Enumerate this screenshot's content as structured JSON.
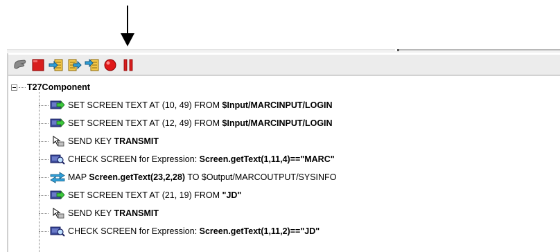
{
  "toolbar": {
    "buttons": [
      {
        "name": "pointer-icon",
        "label": ""
      },
      {
        "name": "stop-icon",
        "label": ""
      },
      {
        "name": "step-into-icon",
        "label": ""
      },
      {
        "name": "step-over-icon",
        "label": ""
      },
      {
        "name": "step-out-icon",
        "label": ""
      },
      {
        "name": "record-icon",
        "label": ""
      },
      {
        "name": "pause-icon",
        "label": ""
      }
    ]
  },
  "tree": {
    "root_label": "T27Component",
    "rows": [
      {
        "icon": "set-screen-icon",
        "prefix": "SET SCREEN TEXT AT (10, 49) FROM ",
        "bold": "$Input/MARCINPUT/LOGIN",
        "suffix": ""
      },
      {
        "icon": "set-screen-icon",
        "prefix": "SET SCREEN TEXT AT (12, 49) FROM ",
        "bold": "$Input/MARCINPUT/LOGIN",
        "suffix": ""
      },
      {
        "icon": "send-key-icon",
        "prefix": "SEND KEY ",
        "bold": "TRANSMIT",
        "suffix": ""
      },
      {
        "icon": "check-screen-icon",
        "prefix": "CHECK SCREEN for Expression: ",
        "bold": "Screen.getText(1,11,4)==\"MARC\"",
        "suffix": ""
      },
      {
        "icon": "map-icon",
        "prefix": "MAP ",
        "bold": "Screen.getText(23,2,28)",
        "suffix": " TO $Output/MARCOUTPUT/SYSINFO"
      },
      {
        "icon": "set-screen-icon",
        "prefix": "SET SCREEN TEXT AT (21, 19) FROM ",
        "bold": "\"JD\"",
        "suffix": ""
      },
      {
        "icon": "send-key-icon",
        "prefix": "SEND KEY ",
        "bold": "TRANSMIT",
        "suffix": ""
      },
      {
        "icon": "check-screen-icon",
        "prefix": "CHECK SCREEN for Expression: ",
        "bold": "Screen.getText(1,11,2)==\"JD\"",
        "suffix": ""
      }
    ]
  }
}
